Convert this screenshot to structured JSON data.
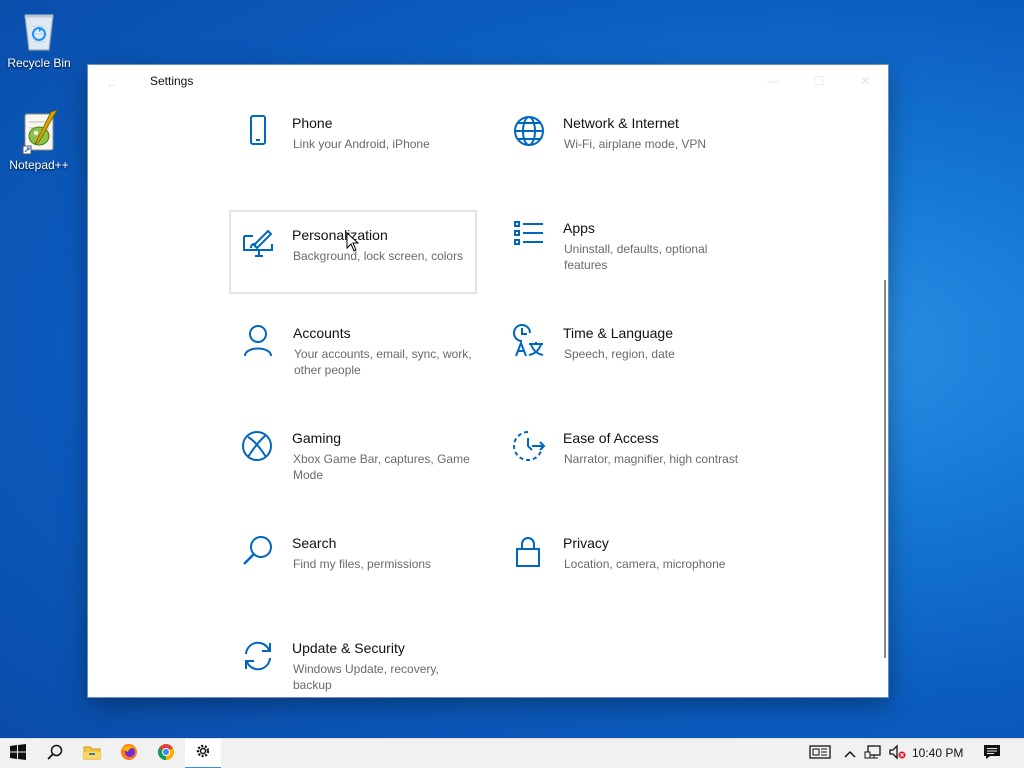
{
  "desktop": {
    "icons": [
      {
        "label": "Recycle Bin",
        "icon": "recycle-bin-icon"
      },
      {
        "label": "Notepad++",
        "icon": "notepad-plus-plus-icon"
      }
    ]
  },
  "window": {
    "title": "Settings",
    "controls": {
      "back": "←",
      "minimize": "—",
      "maximize": "☐",
      "close": "✕"
    },
    "tiles": [
      {
        "name": "Phone",
        "desc": "Link your Android, iPhone",
        "icon": "phone-icon"
      },
      {
        "name": "Network & Internet",
        "desc": "Wi-Fi, airplane mode, VPN",
        "icon": "globe-icon"
      },
      {
        "name": "Personalization",
        "desc": "Background, lock screen, colors",
        "icon": "paintbrush-monitor-icon"
      },
      {
        "name": "Apps",
        "desc": "Uninstall, defaults, optional features",
        "icon": "apps-list-icon"
      },
      {
        "name": "Accounts",
        "desc": "Your accounts, email, sync, work, other people",
        "icon": "person-icon"
      },
      {
        "name": "Time & Language",
        "desc": "Speech, region, date",
        "icon": "time-language-icon"
      },
      {
        "name": "Gaming",
        "desc": "Xbox Game Bar, captures, Game Mode",
        "icon": "xbox-icon"
      },
      {
        "name": "Ease of Access",
        "desc": "Narrator, magnifier, high contrast",
        "icon": "ease-of-access-icon"
      },
      {
        "name": "Search",
        "desc": "Find my files, permissions",
        "icon": "search-icon"
      },
      {
        "name": "Privacy",
        "desc": "Location, camera, microphone",
        "icon": "lock-icon"
      },
      {
        "name": "Update & Security",
        "desc": "Windows Update, recovery, backup",
        "icon": "sync-arrows-icon"
      }
    ]
  },
  "taskbar": {
    "apps": [
      "start-icon",
      "search-icon",
      "file-explorer-icon",
      "firefox-icon",
      "chrome-icon",
      "settings-gear-icon"
    ],
    "tray": [
      "news-icon",
      "chevron-up-icon",
      "network-icon",
      "volume-muted-icon"
    ],
    "clock": "10:40 PM"
  },
  "colors": {
    "accent": "#0067c0",
    "selected_border": "#e3e3e3"
  }
}
